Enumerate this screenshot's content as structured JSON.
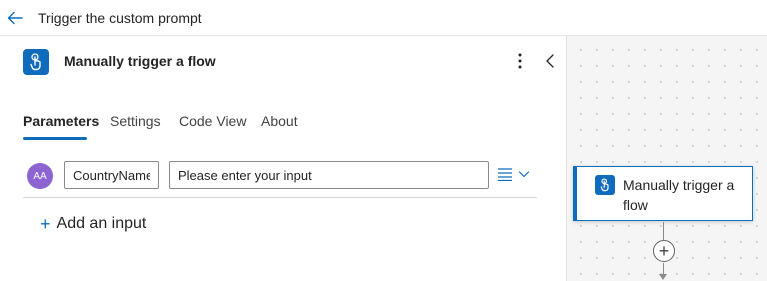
{
  "header": {
    "title": "Trigger the custom prompt"
  },
  "panel": {
    "title": "Manually trigger a flow",
    "tabs": [
      {
        "label": "Parameters",
        "active": true
      },
      {
        "label": "Settings",
        "active": false
      },
      {
        "label": "Code View",
        "active": false
      },
      {
        "label": "About",
        "active": false
      }
    ],
    "input_row": {
      "avatar_text": "AA",
      "name_value": "CountryName",
      "value_placeholder": "Please enter your input"
    },
    "add_input_label": "Add an input"
  },
  "canvas": {
    "node_title": "Manually trigger a flow",
    "add_step_symbol": "+"
  },
  "icons": {
    "back": "back-arrow-icon",
    "trigger": "hand-touch-icon",
    "more": "more-vertical-icon",
    "collapse": "chevron-left-icon",
    "list": "list-icon",
    "expand": "chevron-down-icon",
    "add": "plus-icon"
  },
  "colors": {
    "accent": "#0f6cbd",
    "avatar": "#8e63d2",
    "canvas_bg": "#f5f5f5"
  }
}
